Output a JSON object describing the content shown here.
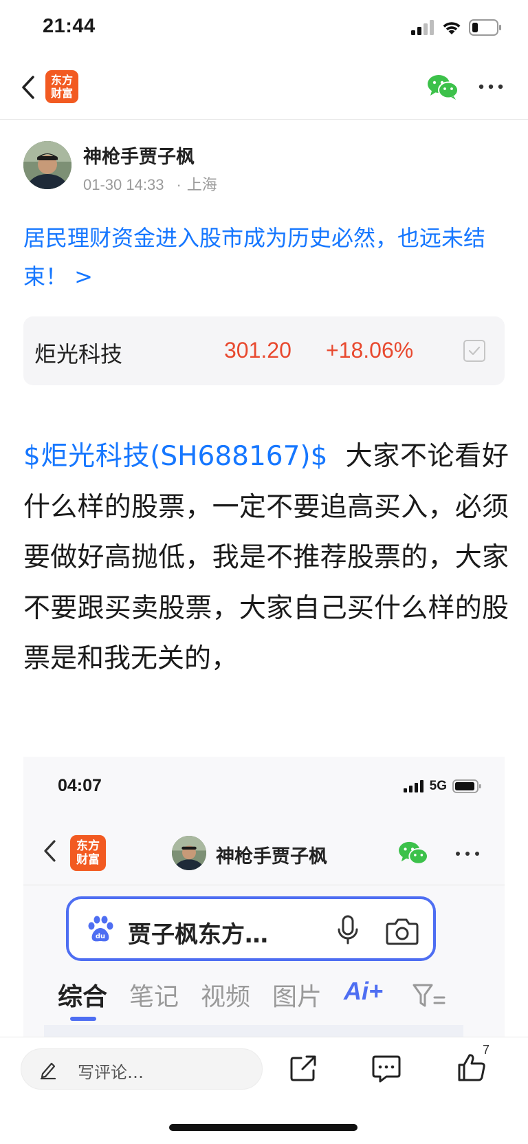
{
  "status_bar": {
    "time": "21:44"
  },
  "nav": {
    "logo_line1": "东方",
    "logo_line2": "财富"
  },
  "author": {
    "name": "神枪手贾子枫",
    "date": "01-30 14:33",
    "location": "上海",
    "separator": "·"
  },
  "headline": "居民理财资金进入股市成为历史必然，也远未结束！ >",
  "stock": {
    "name": "炬光科技",
    "price": "301.20",
    "change": "+18.06%",
    "colors": {
      "up": "#e8492f"
    }
  },
  "post": {
    "stock_link": "$炬光科技(SH688167)$",
    "body": "大家不论看好什么样的股票，一定不要追高买入，必须要做好高抛低，我是不推荐股票的，大家不要跟买卖股票，大家自己买什么样的股票是和我无关的，"
  },
  "embedded": {
    "time": "04:07",
    "network": "5G",
    "logo_line1": "东方",
    "logo_line2": "财富",
    "author_name": "神枪手贾子枫",
    "search_text": "贾子枫东方…",
    "tabs": [
      {
        "label": "综合",
        "active": true
      },
      {
        "label": "笔记",
        "active": false
      },
      {
        "label": "视频",
        "active": false
      },
      {
        "label": "图片",
        "active": false
      }
    ],
    "ai_tab": "Ai+"
  },
  "bottom": {
    "comment_placeholder": "写评论…",
    "like_count": "7"
  },
  "colors": {
    "link": "#1677ff",
    "brand": "#f25a21",
    "baidu": "#4e6ef2"
  }
}
